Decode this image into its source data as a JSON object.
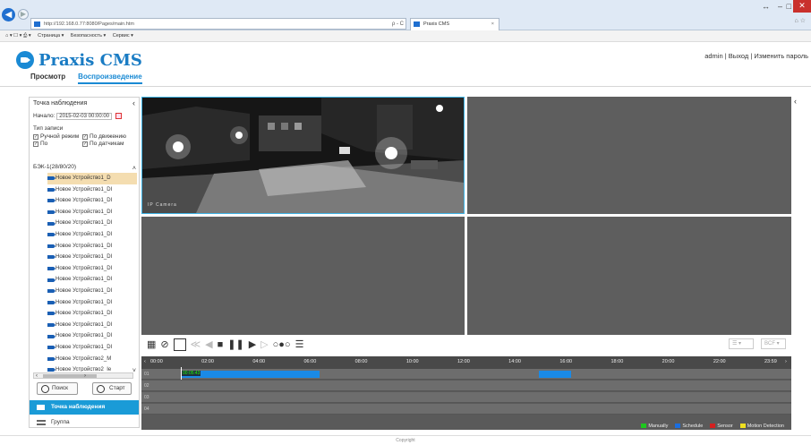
{
  "browser": {
    "url": "http://192.168.0.77:8080/Pages/main.htm",
    "address_tools": "ρ - C",
    "tab_title": "Praxis CMS",
    "tab_close": "×",
    "command_bar": [
      "Страница ▾",
      "Безопасность ▾",
      "Сервис ▾"
    ],
    "window_controls": [
      "↔",
      "–",
      "□",
      "✕"
    ]
  },
  "app": {
    "logo": "Praxis CMS",
    "user": "admin",
    "separator": "|",
    "logout": "Выход",
    "change_password": "Изменить пароль",
    "nav": [
      {
        "label": "Просмотр",
        "active": false
      },
      {
        "label": "Воспроизведение",
        "active": true
      }
    ]
  },
  "left_panel": {
    "title": "Точка наблюдения",
    "collapse": "‹",
    "start_label": "Начало:",
    "start_value": "2015-02-03 00:00:00",
    "record_type_legend": "Тип записи",
    "record_types": [
      {
        "label": "Ручной режим",
        "checked": true
      },
      {
        "label": "По движению",
        "checked": true
      },
      {
        "label": "По",
        "checked": true
      },
      {
        "label": "По датчикам",
        "checked": true
      }
    ],
    "device_group": "БЭК-1(28/80/20)",
    "devices": [
      "Новое Устройство1_D",
      "Новое Устройство1_DI",
      "Новое Устройство1_DI",
      "Новое Устройство1_DI",
      "Новое Устройство1_DI",
      "Новое Устройство1_DI",
      "Новое Устройство1_DI",
      "Новое Устройство1_DI",
      "Новое Устройство1_DI",
      "Новое Устройство1_DI",
      "Новое Устройство1_DI",
      "Новое Устройство1_DI",
      "Новое Устройство1_DI",
      "Новое Устройство1_DI",
      "Новое Устройство1_DI",
      "Новое Устройство1_DI",
      "Новое Устройство2_M",
      "Новое Устройство2_Ie"
    ],
    "search_button": "Поиск",
    "start_button": "Старт",
    "tab_points": "Точка наблюдения",
    "tab_group": "Группа"
  },
  "video": {
    "cam_label": "IP Camera"
  },
  "playback": {
    "dropdown1": "☰ ▾",
    "dropdown2": "BCF ▾"
  },
  "timeline": {
    "hours": [
      "00:00",
      "02:00",
      "04:00",
      "06:00",
      "08:00",
      "10:00",
      "12:00",
      "14:00",
      "16:00",
      "18:00",
      "20:00",
      "22:00",
      "23:59"
    ],
    "left_arrow": "‹",
    "right_arrow": "›",
    "current_time": "00:05:43",
    "channels": [
      "01",
      "02",
      "03",
      "04"
    ],
    "legend": [
      {
        "label": "Manually",
        "color": "#1ec81e"
      },
      {
        "label": "Schedule",
        "color": "#1a6ee0"
      },
      {
        "label": "Sensor",
        "color": "#d42020"
      },
      {
        "label": "Motion Detection",
        "color": "#f0e020"
      }
    ],
    "segment_color": "#1a8ae6"
  },
  "footer": "Copyright"
}
